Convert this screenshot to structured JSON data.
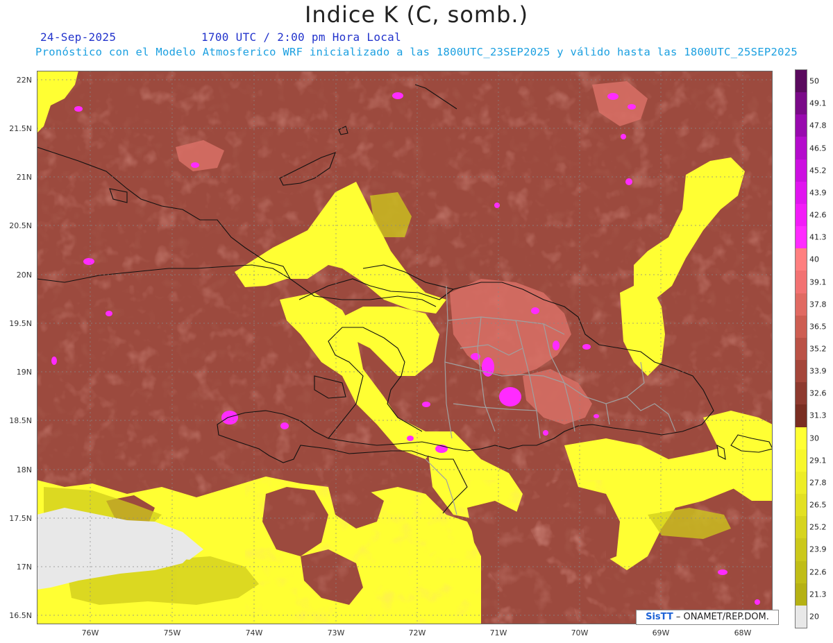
{
  "title": "Indice K (C, somb.)",
  "header": {
    "date": "24-Sep-2025",
    "time": "1700 UTC / 2:00 pm Hora Local",
    "forecast_info": "Pronóstico con el Modelo Atmosferico WRF inicializado a las 1800UTC_23SEP2025 y válido hasta las  1800UTC_25SEP2025"
  },
  "map": {
    "lat_labels": [
      "22N",
      "21.5N",
      "21N",
      "20.5N",
      "20N",
      "19.5N",
      "19N",
      "18.5N",
      "18N",
      "17.5N",
      "17N",
      "16.5N"
    ],
    "lon_labels": [
      "76W",
      "75W",
      "74W",
      "73W",
      "72W",
      "71W",
      "70W",
      "69W",
      "68W"
    ]
  },
  "colorbar": {
    "labels": [
      "50",
      "49.1",
      "47.8",
      "46.5",
      "45.2",
      "43.9",
      "42.6",
      "41.3",
      "40",
      "39.1",
      "37.8",
      "36.5",
      "35.2",
      "33.9",
      "32.6",
      "31.3",
      "30",
      "29.1",
      "27.8",
      "26.5",
      "25.2",
      "23.9",
      "22.6",
      "21.3",
      "20"
    ],
    "colors": [
      "#5a0a5e",
      "#7a0a88",
      "#980aae",
      "#b40ccc",
      "#cc10e0",
      "#e015ef",
      "#f21cf8",
      "#ff2bff",
      "#ff7f7f",
      "#f27272",
      "#e06a62",
      "#cd5e52",
      "#ba5246",
      "#a4463a",
      "#8e3a2f",
      "#7a2e22",
      "#ffff33",
      "#f7f72c",
      "#eded27",
      "#e2e022",
      "#d6d41e",
      "#cbc81b",
      "#c0bd17",
      "#b5b114",
      "#e8e8e8"
    ]
  },
  "credit": {
    "logo": "SisTT",
    "text": "– ONAMET/REP.DOM."
  },
  "colors": {
    "header_date": "#2233cc",
    "header_info": "#1a9fe0",
    "ocean_low": "#e8e8e8",
    "yellow": "#ffff33",
    "brown": "#9c4a3e",
    "pink": "#d97066",
    "magenta": "#ff2bff",
    "coast": "#111111",
    "province": "#a0a0a0"
  }
}
